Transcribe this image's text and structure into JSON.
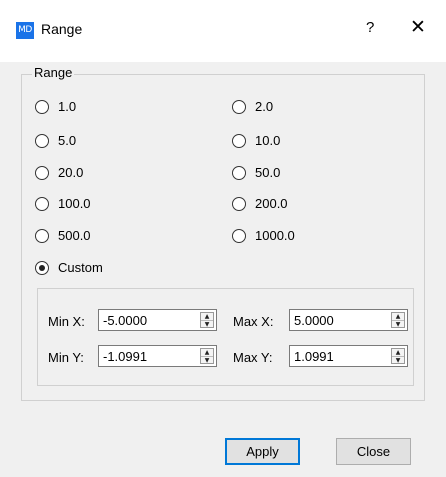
{
  "window": {
    "app_icon_text": "MD",
    "title": "Range",
    "help": "?",
    "close": "✕"
  },
  "group": {
    "title": "Range",
    "options": [
      "1.0",
      "2.0",
      "5.0",
      "10.0",
      "20.0",
      "50.0",
      "100.0",
      "200.0",
      "500.0",
      "1000.0",
      "Custom"
    ],
    "selected": "Custom"
  },
  "custom": {
    "min_x_label": "Min X:",
    "min_x_value": "-5.0000",
    "max_x_label": "Max X:",
    "max_x_value": "5.0000",
    "min_y_label": "Min Y:",
    "min_y_value": "-1.0991",
    "max_y_label": "Max Y:",
    "max_y_value": "1.0991"
  },
  "buttons": {
    "apply": "Apply",
    "close": "Close"
  },
  "colors": {
    "accent": "#0078d7",
    "app_icon_bg": "#1a73e8",
    "dialog_bg": "#f0f0f0"
  }
}
